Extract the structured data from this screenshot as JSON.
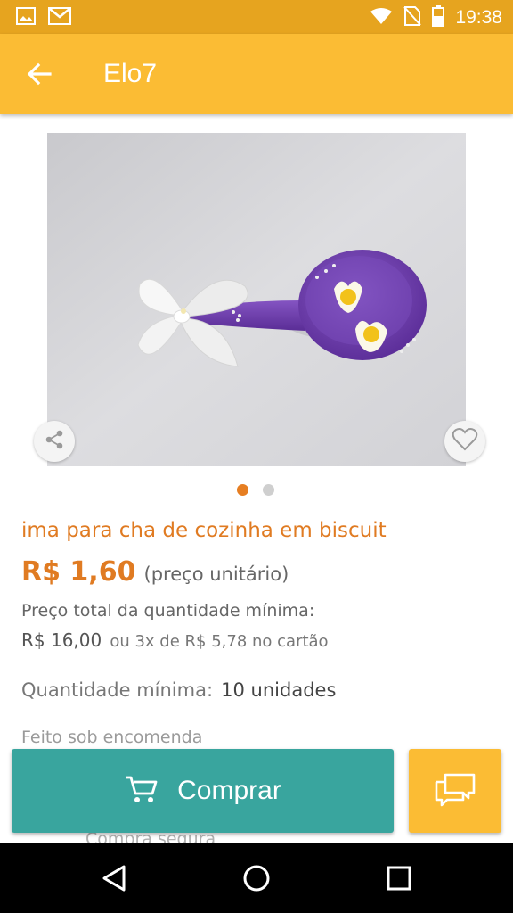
{
  "status_bar": {
    "time": "19:38",
    "icons": [
      "gallery-icon",
      "gmail-icon",
      "wifi-icon",
      "no-sim-icon",
      "battery-icon"
    ]
  },
  "app_bar": {
    "title": "Elo7",
    "back_icon": "arrow-back-icon"
  },
  "gallery": {
    "image_count": 2,
    "active_index": 0
  },
  "product": {
    "title": "ima para cha de cozinha em biscuit",
    "price": "R$ 1,60",
    "price_unit": "(preço unitário)",
    "total_label": "Preço total da quantidade mínima:",
    "total_value": "R$ 16,00",
    "installments": "ou 3x de R$ 5,78 no cartão",
    "min_qty_label": "Quantidade mínima:",
    "min_qty_value": "10 unidades",
    "made_to_order": "Feito sob encomenda",
    "safe_purchase": "Compra segura"
  },
  "actions": {
    "buy_label": "Comprar",
    "buy_icon": "cart-icon",
    "chat_icon": "chat-icon",
    "share_icon": "share-icon",
    "favorite_icon": "heart-icon"
  },
  "colors": {
    "status_bar": "#e6a41f",
    "app_bar": "#fbbc34",
    "accent_orange": "#e07b22",
    "buy_button": "#39a59e",
    "chat_button": "#fbbc34"
  }
}
